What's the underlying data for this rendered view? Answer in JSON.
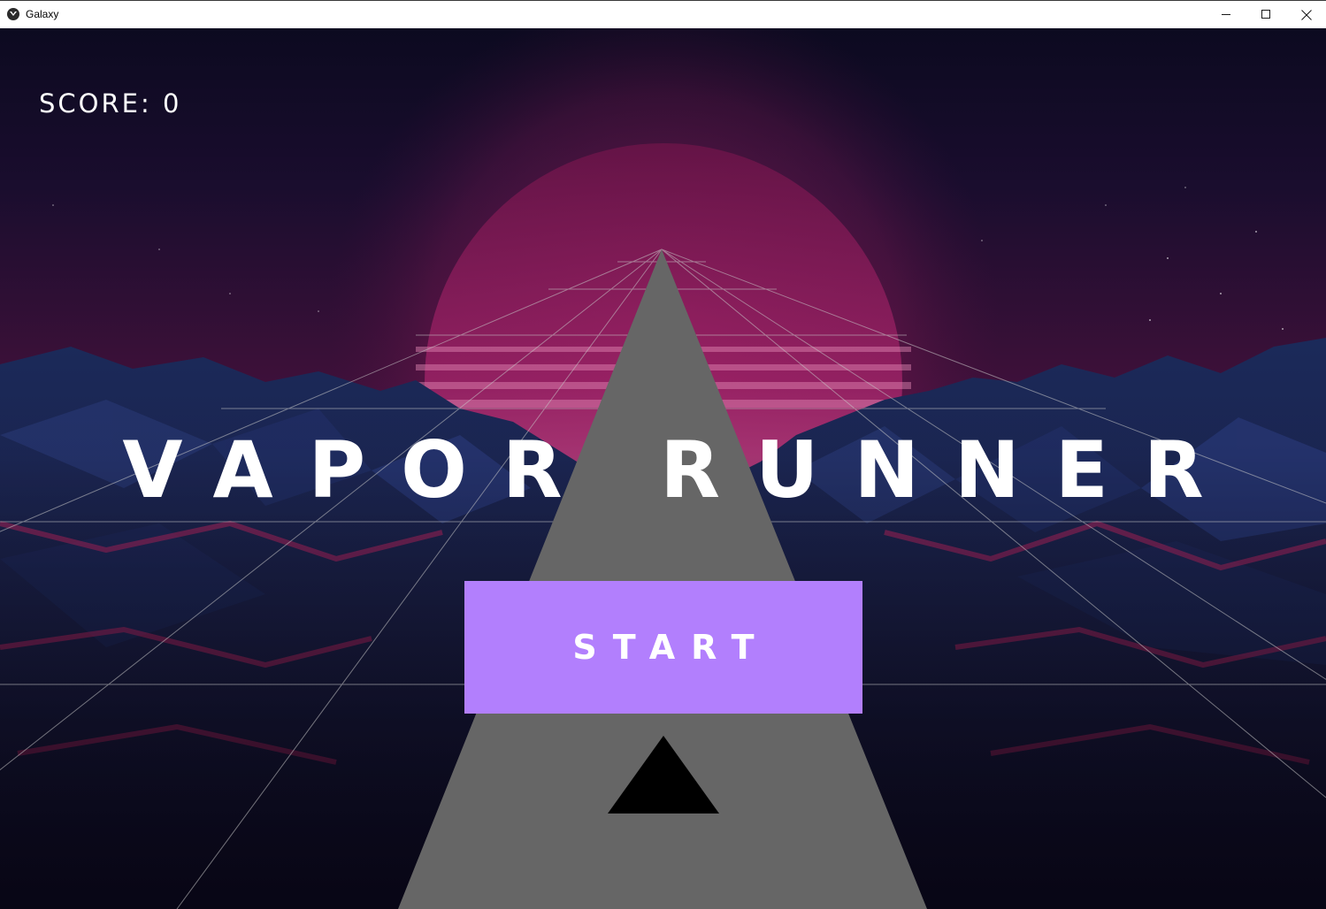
{
  "window": {
    "title": "Galaxy",
    "controls": [
      "minimize",
      "maximize",
      "close"
    ]
  },
  "game": {
    "score_text": "SCORE: 0",
    "title": "VAPOR RUNNER",
    "start_button_label": "START",
    "ship_icon": "triangle-ship-icon"
  },
  "colors": {
    "start_button": "#b27ffd",
    "road": "#666666",
    "ship": "#000000",
    "sun": "#a8236a",
    "sky_top": "#0d0b24",
    "sky_horizon": "#4a1240",
    "mountains": "#1a2650",
    "grid_lines": "#c8c8c8",
    "text": "#ffffff"
  }
}
